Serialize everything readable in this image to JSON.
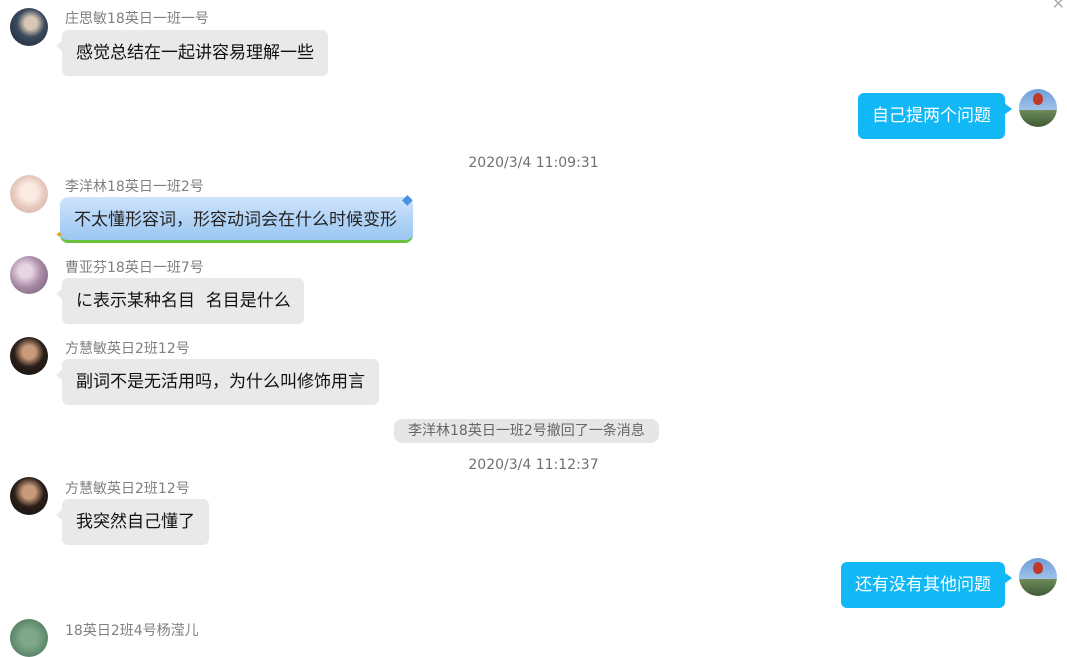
{
  "window": {
    "close_glyph": "✕"
  },
  "messages": [
    {
      "sender": "庄思敏18英日一班一号",
      "text": "感觉总结在一起讲容易理解一些"
    },
    {
      "text": "自己提两个问题"
    },
    {
      "timestamp": "2020/3/4 11:09:31"
    },
    {
      "sender": "李洋林18英日一班2号",
      "text": "不太懂形容词，形容动词会在什么时候变形"
    },
    {
      "sender": "曹亚芬18英日一班7号",
      "text": "に表示某种名目  名目是什么"
    },
    {
      "sender": "方慧敏英日2班12号",
      "text": "副词不是无活用吗，为什么叫修饰用言"
    },
    {
      "system": "李洋林18英日一班2号撤回了一条消息"
    },
    {
      "timestamp": "2020/3/4 11:12:37"
    },
    {
      "sender": "方慧敏英日2班12号",
      "text": "我突然自己懂了"
    },
    {
      "text": "还有没有其他问题"
    },
    {
      "sender": "18英日2班4号杨滢儿"
    }
  ],
  "colors": {
    "outgoing_bubble": "#12b7f5",
    "incoming_bubble": "#e9e9e9",
    "sender_name": "#808080"
  }
}
